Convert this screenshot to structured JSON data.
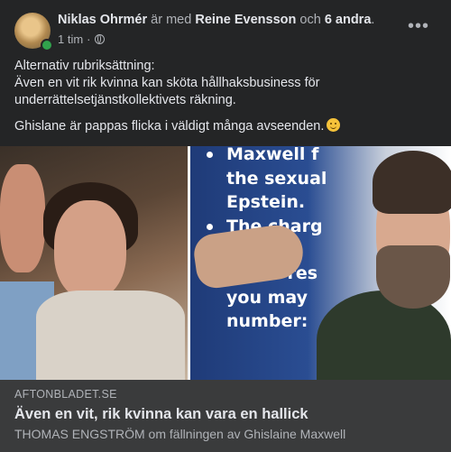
{
  "post": {
    "author": "Niklas Ohrmér",
    "with_text": "är med",
    "tagged": "Reine Evensson",
    "and_text": "och",
    "others": "6 andra",
    "time": "1 tim",
    "dot": "·",
    "privacy_icon": "globe-icon",
    "more_icon": "more-options-icon",
    "more_label": "•••",
    "text_lines": [
      "Alternativ rubriksättning:",
      "Även en vit rik kvinna kan sköta hållhaksbusiness för underrättelsetjänstkollektivets räkning."
    ],
    "text_second": "Ghislane är pappas flicka i väldigt många avseenden."
  },
  "image": {
    "slide_lines": [
      "Maxwell f",
      "the sexual",
      "Epstein.",
      "The charg",
      "If you res",
      "you may",
      "number:"
    ]
  },
  "link": {
    "domain": "AFTONBLADET.SE",
    "headline": "Även en vit, rik kvinna kan vara en hallick",
    "description": "THOMAS ENGSTRÖM om fällningen av Ghislaine Maxwell"
  },
  "colors": {
    "background": "#242526",
    "link_box": "#3a3b3c",
    "online": "#31a24c"
  }
}
